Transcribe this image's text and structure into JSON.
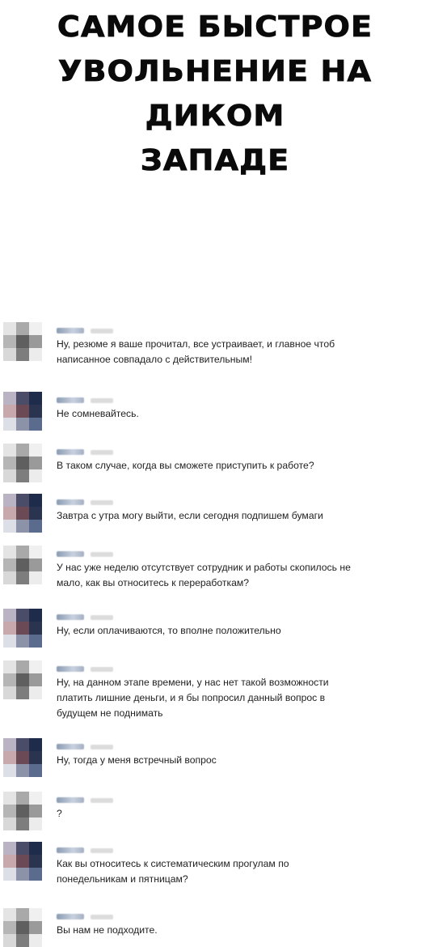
{
  "title": {
    "line1": "САМОЕ БЫСТРОЕ",
    "line2": "УВОЛЬНЕНИЕ НА ДИКОМ",
    "line3": "ЗАПАДЕ"
  },
  "messages": [
    {
      "sender": "employer",
      "text": "Ну, резюме я ваше прочитал, все устраивает, и главное чтоб\nнаписанное совпадало с действительным!"
    },
    {
      "sender": "applicant",
      "text": "Не сомневайтесь."
    },
    {
      "sender": "employer",
      "text": "В таком случае, когда вы сможете приступить к работе?"
    },
    {
      "sender": "applicant",
      "text": "Завтра с утра могу выйти, если сегодня подпишем бумаги"
    },
    {
      "sender": "employer",
      "text": "У нас уже неделю отсутствует сотрудник и работы скопилось не\nмало, как вы относитесь к переработкам?"
    },
    {
      "sender": "applicant",
      "text": "Ну, если оплачиваются, то вполне положительно"
    },
    {
      "sender": "employer",
      "text": "Ну, на данном этапе времени, у нас нет такой возможности\nплатить лишние деньги, и я бы попросил данный вопрос в\nбудущем не поднимать"
    },
    {
      "sender": "applicant",
      "text": "Ну, тогда у меня встречный вопрос"
    },
    {
      "sender": "employer",
      "text": "?"
    },
    {
      "sender": "applicant",
      "text": "Как вы относитесь к систематическим прогулам по\nпонедельникам и пятницам?"
    },
    {
      "sender": "employer",
      "text": "Вы нам не подходите."
    }
  ],
  "avatar_colors": {
    "employer": [
      "#e4e4e4",
      "#a9a9a9",
      "#f0f0f0",
      "#b5b5b5",
      "#5f5f5f",
      "#9a9a9a",
      "#d8d8d8",
      "#7d7d7d",
      "#ececec"
    ],
    "applicant": [
      "#b9b3c4",
      "#4a4c68",
      "#1f2b4a",
      "#c7a9ad",
      "#6b4a55",
      "#2a3450",
      "#dcdfe6",
      "#8c93a8",
      "#5b6b8e"
    ]
  }
}
